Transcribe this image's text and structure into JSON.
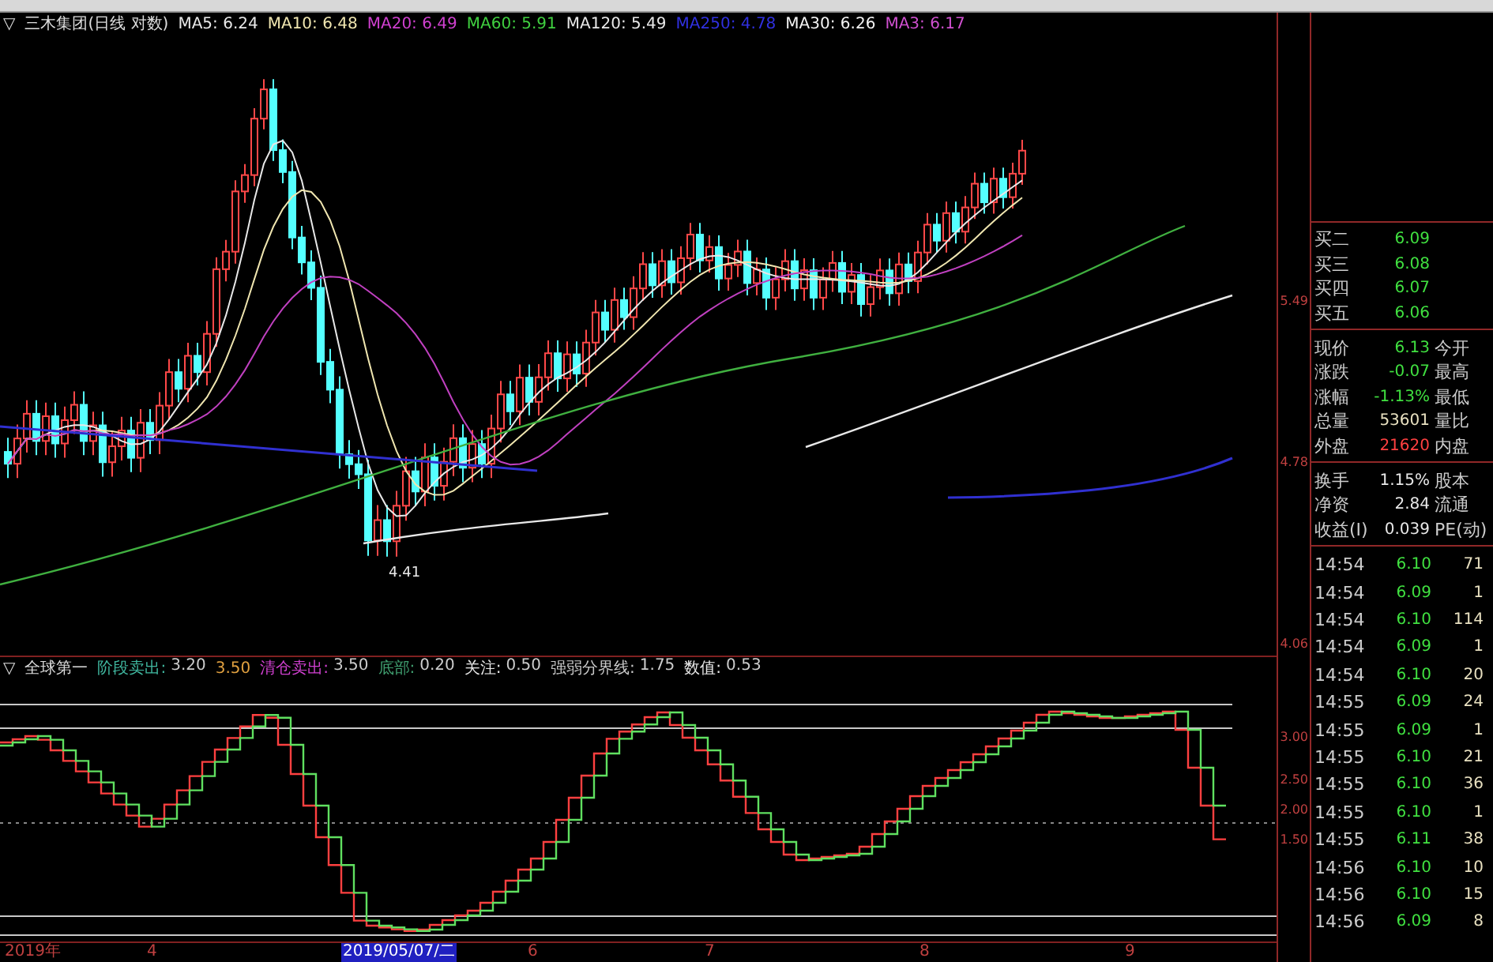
{
  "chart_header": {
    "toggle": "▽",
    "title": "三木集团(日线 对数)",
    "ma": [
      {
        "label": "MA5:",
        "value": "6.24",
        "color": "#e8e8e8"
      },
      {
        "label": "MA10:",
        "value": "6.48",
        "color": "#f0e6b0"
      },
      {
        "label": "MA20:",
        "value": "6.49",
        "color": "#d040d0"
      },
      {
        "label": "MA60:",
        "value": "5.91",
        "color": "#40d040"
      },
      {
        "label": "MA120:",
        "value": "5.49",
        "color": "#e8e8e8"
      },
      {
        "label": "MA250:",
        "value": "4.78",
        "color": "#3030e0"
      },
      {
        "label": "MA30:",
        "value": "6.26",
        "color": "#f4f4f4"
      },
      {
        "label": "MA3:",
        "value": "6.17",
        "color": "#d050d0"
      }
    ]
  },
  "main_pane": {
    "low_marker": "4.41",
    "y_ticks": [
      "5.49",
      "4.78",
      "4.06"
    ]
  },
  "indicator_header": {
    "toggle": "▽",
    "name": "全球第一",
    "items": [
      {
        "label": "阶段卖出:",
        "value": "3.20",
        "color": "#40b8a0"
      },
      {
        "value": "3.50",
        "color": "#e0a040"
      },
      {
        "label": "清仓卖出:",
        "value": "3.50",
        "color": "#d040d0"
      },
      {
        "label": "底部:",
        "value": "0.20",
        "color": "#40a070"
      },
      {
        "label": "关注:",
        "value": "0.50",
        "color": "#e8e8e8"
      },
      {
        "label": "强弱分界线:",
        "value": "1.75",
        "color": "#c8c8c8"
      },
      {
        "label": "数值:",
        "value": "0.53",
        "color": "#e8e8e8"
      }
    ]
  },
  "indicator_pane": {
    "y_ticks": [
      "3.00",
      "2.50",
      "2.00",
      "1.50"
    ]
  },
  "x_axis": [
    {
      "label": "2019年",
      "selected": false
    },
    {
      "label": "4",
      "selected": false
    },
    {
      "label": "2019/05/07/二",
      "selected": true
    },
    {
      "label": "6",
      "selected": false
    },
    {
      "label": "7",
      "selected": false
    },
    {
      "label": "8",
      "selected": false
    },
    {
      "label": "9",
      "selected": false
    }
  ],
  "quote": {
    "bids": [
      {
        "label": "买二",
        "value": "6.09"
      },
      {
        "label": "买三",
        "value": "6.08"
      },
      {
        "label": "买四",
        "value": "6.07"
      },
      {
        "label": "买五",
        "value": "6.06"
      }
    ],
    "stats": [
      {
        "label": "现价",
        "value": "6.13",
        "color": "#40e040",
        "extra": "今开"
      },
      {
        "label": "涨跌",
        "value": "-0.07",
        "color": "#40e040",
        "extra": "最高"
      },
      {
        "label": "涨幅",
        "value": "-1.13%",
        "color": "#40e040",
        "extra": "最低"
      },
      {
        "label": "总量",
        "value": "53601",
        "color": "#e8e0c0",
        "extra": "量比"
      },
      {
        "label": "外盘",
        "value": "21620",
        "color": "#ff4040",
        "extra": "内盘"
      }
    ],
    "finance": [
      {
        "label": "换手",
        "value": "1.15%",
        "extra": "股本"
      },
      {
        "label": "净资",
        "value": "2.84",
        "extra": "流通"
      },
      {
        "label": "收益(I)",
        "value": "0.039",
        "extra": "PE(动)"
      }
    ]
  },
  "ticks": [
    {
      "time": "14:54",
      "price": "6.10",
      "volume": "71"
    },
    {
      "time": "14:54",
      "price": "6.09",
      "volume": "1"
    },
    {
      "time": "14:54",
      "price": "6.10",
      "volume": "114"
    },
    {
      "time": "14:54",
      "price": "6.09",
      "volume": "1"
    },
    {
      "time": "14:54",
      "price": "6.10",
      "volume": "20"
    },
    {
      "time": "14:55",
      "price": "6.09",
      "volume": "24"
    },
    {
      "time": "14:55",
      "price": "6.09",
      "volume": "1"
    },
    {
      "time": "14:55",
      "price": "6.10",
      "volume": "21"
    },
    {
      "time": "14:55",
      "price": "6.10",
      "volume": "36"
    },
    {
      "time": "14:55",
      "price": "6.10",
      "volume": "1"
    },
    {
      "time": "14:55",
      "price": "6.11",
      "volume": "38"
    },
    {
      "time": "14:56",
      "price": "6.10",
      "volume": "10"
    },
    {
      "time": "14:56",
      "price": "6.10",
      "volume": "15"
    },
    {
      "time": "14:56",
      "price": "6.09",
      "volume": "8"
    }
  ]
}
